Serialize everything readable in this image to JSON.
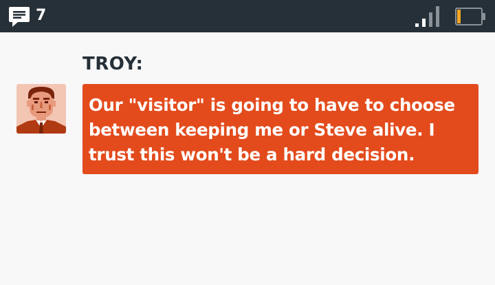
{
  "status_bar": {
    "message_icon": "chat-bubble-icon",
    "message_count": "7",
    "signal_icon": "signal-strength-icon",
    "signal_bars_lit": 2,
    "signal_bars_total": 4,
    "battery_icon": "battery-icon",
    "battery_level": 0.15,
    "colors": {
      "bar_background": "#263038",
      "icon_white": "#ffffff",
      "signal_unlit": "#8a9299",
      "battery_fill": "#f5a623"
    }
  },
  "conversation": {
    "speaker": "TROY:",
    "avatar_icon": "troy-portrait-avatar",
    "message": "Our \"visitor\" is going to have to choose between keeping me or Steve alive. I trust this won't be a hard decision.",
    "colors": {
      "bubble": "#e34b1c",
      "text": "#ffffff",
      "name": "#263038",
      "background": "#f8f8f8"
    }
  }
}
